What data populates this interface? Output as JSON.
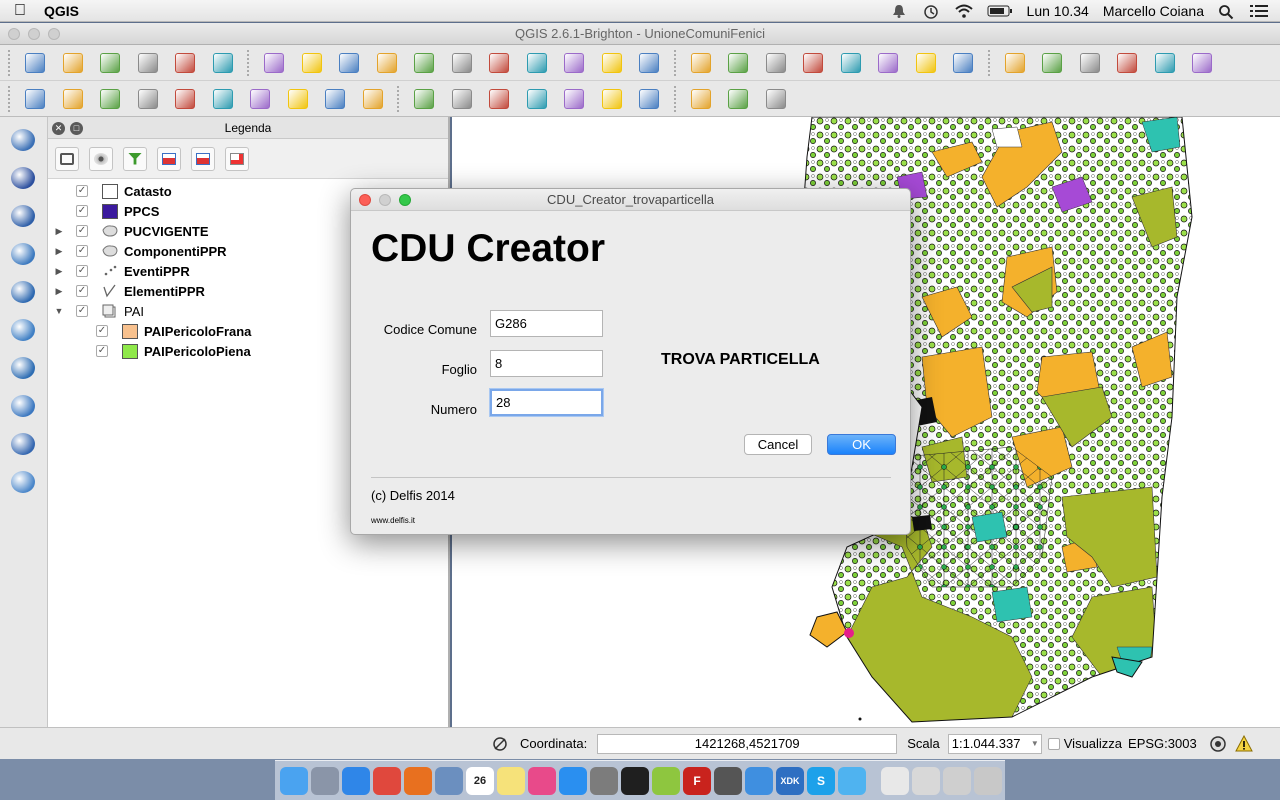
{
  "menubar": {
    "app_name": "QGIS",
    "clock": "Lun 10.34",
    "user": "Marcello Coiana"
  },
  "window": {
    "title": "QGIS 2.6.1-Brighton - UnioneComuniFenici"
  },
  "legend": {
    "title": "Legenda",
    "layers": [
      {
        "name": "Catasto",
        "bold": true,
        "expandable": false,
        "indent": 0,
        "symbol": "#ffffff"
      },
      {
        "name": "PPCS",
        "bold": true,
        "expandable": false,
        "indent": 0,
        "symbol": "#3b1a9e"
      },
      {
        "name": "PUCVIGENTE",
        "bold": true,
        "expandable": true,
        "indent": 0,
        "symbol": "polygon-icon"
      },
      {
        "name": "ComponentiPPR",
        "bold": true,
        "expandable": true,
        "indent": 0,
        "symbol": "polygon-icon"
      },
      {
        "name": "EventiPPR",
        "bold": true,
        "expandable": true,
        "indent": 0,
        "symbol": "point-icon"
      },
      {
        "name": "ElementiPPR",
        "bold": true,
        "expandable": true,
        "indent": 0,
        "symbol": "line-icon"
      },
      {
        "name": "PAI",
        "bold": false,
        "expandable": true,
        "expanded": true,
        "indent": 0,
        "symbol": "group-icon"
      },
      {
        "name": "PAIPericoloFrana",
        "bold": true,
        "expandable": false,
        "indent": 1,
        "symbol": "#f8c18e"
      },
      {
        "name": "PAIPericoloPiena",
        "bold": true,
        "expandable": false,
        "indent": 1,
        "symbol": "#8fe84a"
      }
    ]
  },
  "dialog": {
    "title": "CDU_Creator_trovaparticella",
    "heading": "CDU Creator",
    "fields": {
      "comune_label": "Codice Comune",
      "comune_value": "G286",
      "foglio_label": "Foglio",
      "foglio_value": "8",
      "numero_label": "Numero",
      "numero_value": "28"
    },
    "find_label": "TROVA PARTICELLA",
    "cancel_label": "Cancel",
    "ok_label": "OK",
    "copyright": "(c) Delfis 2014",
    "website": "www.delfis.it"
  },
  "statusbar": {
    "coord_label": "Coordinata:",
    "coord_value": "1421268,4521709",
    "scale_label": "Scala",
    "scale_value": "1:1.044.337",
    "render_label": "Visualizza",
    "crs": "EPSG:3003"
  },
  "toolbar_icons": {
    "row1": [
      "new-project-icon",
      "open-project-icon",
      "save-project-icon",
      "save-as-icon",
      "new-print-composer-icon",
      "composer-manager-icon",
      "pan-icon",
      "pan-to-selection-icon",
      "zoom-in-icon",
      "zoom-out-icon",
      "zoom-native-icon",
      "zoom-full-icon",
      "zoom-to-selection-icon",
      "zoom-to-layer-icon",
      "zoom-last-icon",
      "zoom-next-icon",
      "refresh-icon",
      "identify-icon",
      "action-icon",
      "select-icon",
      "deselect-icon",
      "expression-select-icon",
      "attribute-table-icon",
      "field-calculator-icon",
      "measure-icon",
      "map-tips-icon",
      "new-bookmark-icon",
      "show-bookmarks-icon",
      "text-annotation-icon",
      "help-icon",
      "whats-this-icon"
    ],
    "row2": [
      "current-edits-icon",
      "toggle-editing-icon",
      "save-edits-icon",
      "add-feature-icon",
      "move-feature-icon",
      "node-tool-icon",
      "delete-selected-icon",
      "cut-features-icon",
      "copy-features-icon",
      "paste-features-icon",
      "label-icon",
      "pin-labels-icon",
      "highlight-pinned-icon",
      "show-hide-labels-icon",
      "move-label-icon",
      "rotate-label-icon",
      "change-label-icon",
      "cdu-plugin-icon",
      "search-icon",
      "plugin-icon"
    ],
    "vertical": [
      "add-vector-layer-icon",
      "add-raster-layer-icon",
      "add-postgis-layer-icon",
      "add-spatialite-layer-icon",
      "add-mssql-layer-icon",
      "add-wms-layer-icon",
      "add-wcs-layer-icon",
      "add-wfs-layer-icon",
      "add-delimited-text-icon",
      "new-shapefile-icon"
    ]
  },
  "dock_apps": [
    "finder",
    "launchpad",
    "safari",
    "chrome",
    "firefox",
    "preview",
    "calendar",
    "notes",
    "itunes",
    "app-store",
    "system-preferences",
    "terminal",
    "qgis",
    "filezilla",
    "github",
    "xcode",
    "intel-xdk",
    "skype",
    "messages",
    "documents",
    "mail",
    "photos",
    "trash"
  ],
  "dock_labels": {
    "calendar_day": "26",
    "filezilla_letter": "F",
    "skype_letter": "S",
    "xdk_text": "XDK"
  }
}
